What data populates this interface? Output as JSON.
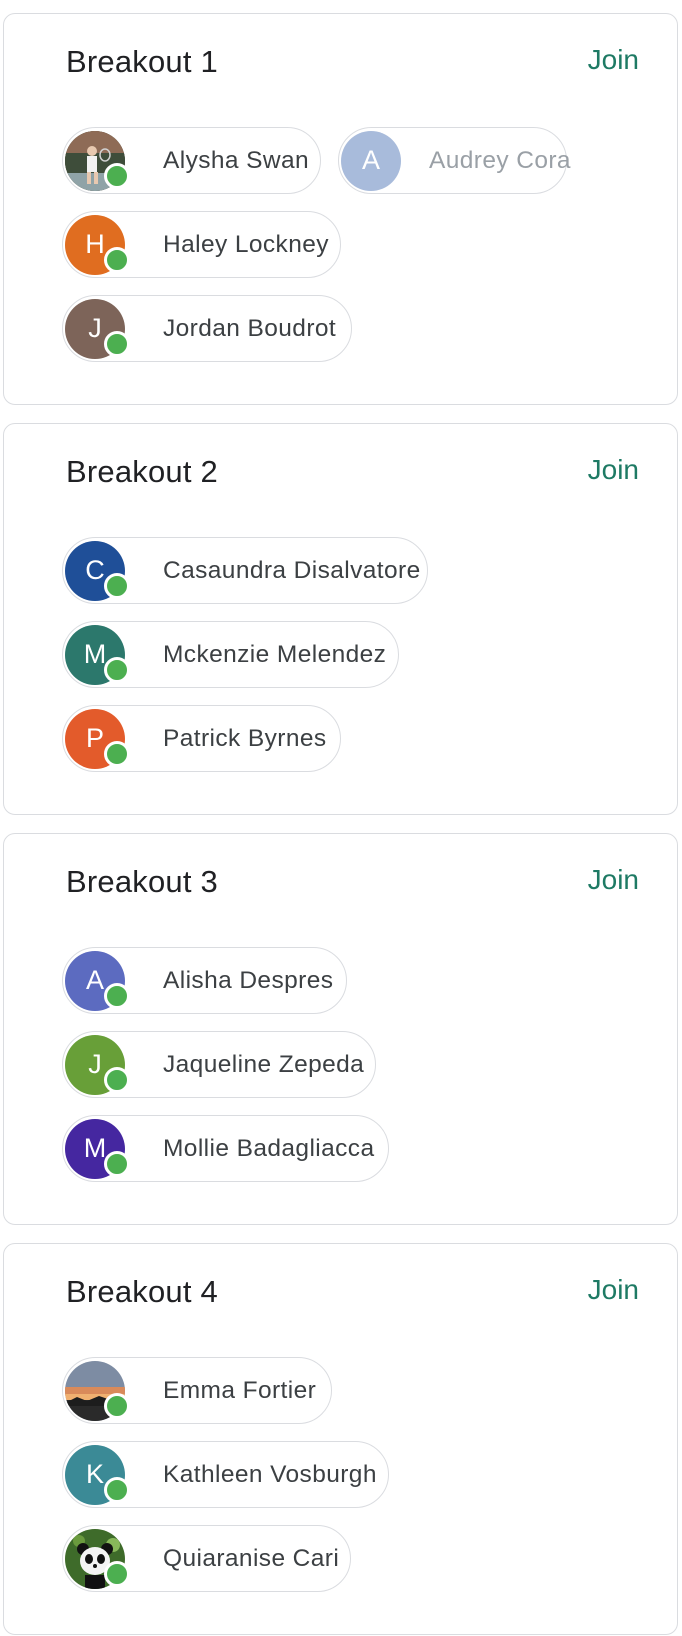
{
  "join_label": "Join",
  "rooms": [
    {
      "title": "Breakout 1",
      "participants": [
        {
          "name": "Alysha Swan",
          "initial": "",
          "avatar": "photo-tennis",
          "online": true
        },
        {
          "name": "Audrey Cora",
          "initial": "A",
          "color": "#a8bbdb",
          "online": false
        },
        {
          "name": "Haley Lockney",
          "initial": "H",
          "color": "#e06d20",
          "online": true
        },
        {
          "name": "Jordan Boudrot",
          "initial": "J",
          "color": "#7d6459",
          "online": true
        }
      ]
    },
    {
      "title": "Breakout 2",
      "participants": [
        {
          "name": "Casaundra Disalvatore",
          "initial": "C",
          "color": "#1f4f98",
          "online": true
        },
        {
          "name": "Mckenzie Melendez",
          "initial": "M",
          "color": "#2c786c",
          "online": true
        },
        {
          "name": "Patrick Byrnes",
          "initial": "P",
          "color": "#e35b2b",
          "online": true
        }
      ]
    },
    {
      "title": "Breakout 3",
      "participants": [
        {
          "name": "Alisha Despres",
          "initial": "A",
          "color": "#5c6bc0",
          "online": true
        },
        {
          "name": "Jaqueline Zepeda",
          "initial": "J",
          "color": "#689f38",
          "online": true
        },
        {
          "name": "Mollie Badagliacca",
          "initial": "M",
          "color": "#4527a0",
          "online": true
        }
      ]
    },
    {
      "title": "Breakout 4",
      "participants": [
        {
          "name": "Emma Fortier",
          "initial": "",
          "avatar": "photo-sunset",
          "online": true
        },
        {
          "name": "Kathleen Vosburgh",
          "initial": "K",
          "color": "#3b8a96",
          "online": true
        },
        {
          "name": "Quiaranise Cari",
          "initial": "",
          "avatar": "photo-panda",
          "online": true
        }
      ]
    }
  ]
}
